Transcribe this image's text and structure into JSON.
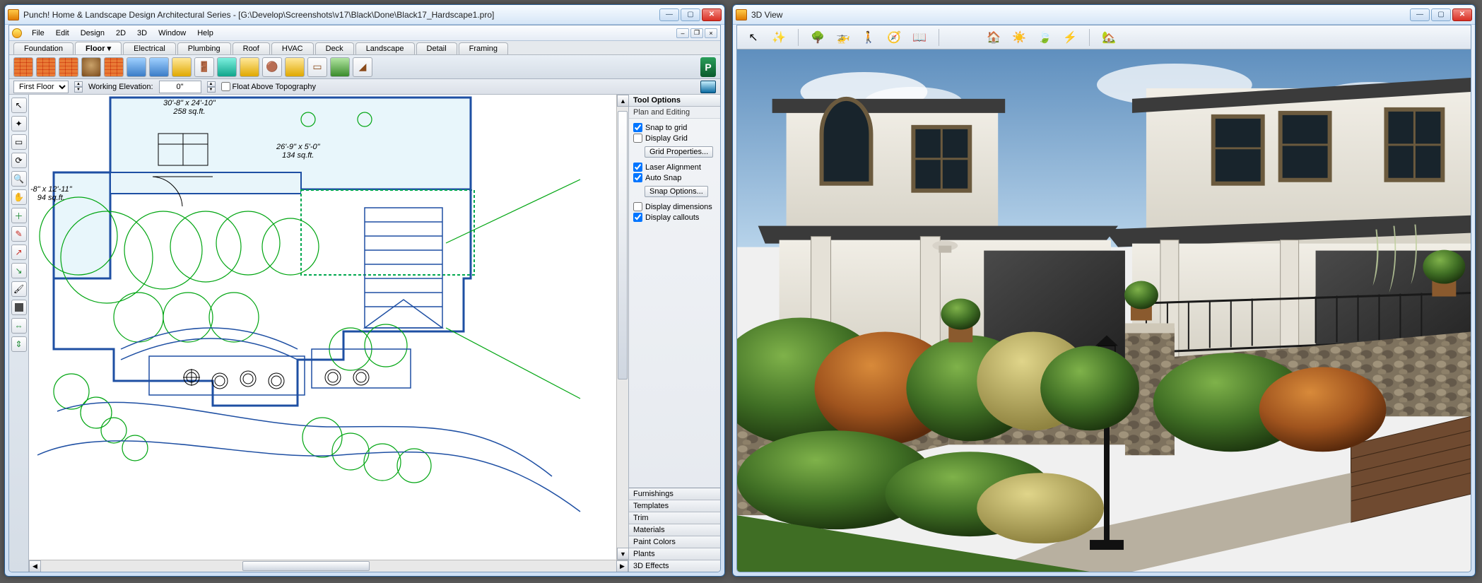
{
  "left_window": {
    "title": "Punch! Home & Landscape Design Architectural Series - [G:\\Develop\\Screenshots\\v17\\Black\\Done\\Black17_Hardscape1.pro]",
    "menu": [
      "File",
      "Edit",
      "Design",
      "2D",
      "3D",
      "Window",
      "Help"
    ],
    "tabs": [
      "Foundation",
      "Floor",
      "Electrical",
      "Plumbing",
      "Roof",
      "HVAC",
      "Deck",
      "Landscape",
      "Detail",
      "Framing"
    ],
    "active_tab": "Floor",
    "options": {
      "floor_selector": "First Floor",
      "working_elev_label": "Working Elevation:",
      "working_elev_value": "0\"",
      "float_above_topo": "Float Above Topography",
      "float_checked": false
    },
    "dimensions": {
      "room_a_dim": "30'-8\" x 24'-10\"",
      "room_a_area": "258 sq.ft.",
      "room_b_dim": "26'-9\" x 5'-0\"",
      "room_b_area": "134 sq.ft.",
      "room_c_dim": "-8\" x 12'-11\"",
      "room_c_area": "94 sq.ft."
    },
    "tool_options": {
      "title": "Tool Options",
      "subtitle": "Plan and Editing",
      "snap_to_grid": "Snap to grid",
      "display_grid": "Display Grid",
      "grid_properties_btn": "Grid Properties...",
      "laser_alignment": "Laser Alignment",
      "auto_snap": "Auto Snap",
      "snap_options_btn": "Snap Options...",
      "display_dimensions": "Display dimensions",
      "display_callouts": "Display callouts"
    },
    "accordion": [
      "Furnishings",
      "Templates",
      "Trim",
      "Materials",
      "Paint Colors",
      "Plants",
      "3D Effects"
    ],
    "vtool_tips": {
      "select": "select",
      "lasso": "lasso-select",
      "marquee": "marquee",
      "rotate": "rotate",
      "zoom": "zoom",
      "pan": "pan",
      "add": "add-point",
      "eyedrop": "eyedropper",
      "bounds-out": "grow-bounds",
      "bounds-in": "shrink-bounds",
      "paint": "paint",
      "grid": "checker",
      "dim1": "dimension-1",
      "dim2": "dimension-2"
    },
    "main_toolbar": [
      "brick-wall",
      "brick-wall-2",
      "brick-wall-3",
      "barrel",
      "brick-wall-4",
      "column",
      "column-2",
      "counter",
      "door",
      "window",
      "table",
      "stool",
      "cabinet",
      "fridge",
      "plank",
      "plant",
      "roof-edge"
    ],
    "p_logo": "P"
  },
  "right_window": {
    "title": "3D View",
    "toolbar_icons_left": [
      "cursor",
      "wand",
      "tree",
      "helicopter",
      "walk",
      "compass",
      "book"
    ],
    "toolbar_icons_right": [
      "house",
      "sun",
      "wind",
      "lightning",
      "home-small"
    ]
  }
}
